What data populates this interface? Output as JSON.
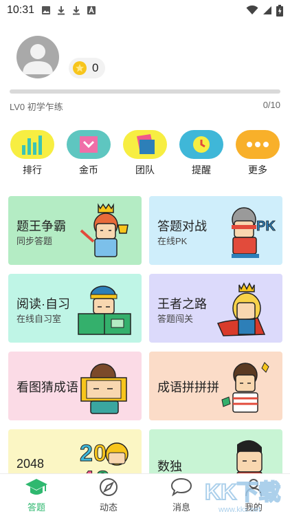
{
  "status_bar": {
    "time": "10:31",
    "left_icons": [
      "image-icon",
      "download-icon",
      "download-icon",
      "font-icon"
    ],
    "right_icons": [
      "wifi-icon",
      "signal-icon",
      "battery-icon"
    ]
  },
  "profile": {
    "avatar_icon": "user-avatar-icon",
    "coin_count": "0",
    "level_label": "LV0 初学乍练",
    "progress_text": "0/10",
    "progress_fraction": 0.0
  },
  "quick_actions": [
    {
      "label": "排行",
      "icon": "bar-chart-icon",
      "color": "#f7ee42"
    },
    {
      "label": "金币",
      "icon": "coin-box-icon",
      "color": "#5ec6c0"
    },
    {
      "label": "团队",
      "icon": "team-flag-icon",
      "color": "#f7ee42"
    },
    {
      "label": "提醒",
      "icon": "clock-icon",
      "color": "#3fb7d8"
    },
    {
      "label": "更多",
      "icon": "more-dots-icon",
      "color": "#f8b02a"
    }
  ],
  "cards": [
    {
      "title": "题王争霸",
      "subtitle": "同步答题",
      "bg": "#b4ecc4",
      "art": "crowned-boy-trophy-icon"
    },
    {
      "title": "答题对战",
      "subtitle": "在线PK",
      "bg": "#cfeefb",
      "art": "ninja-pk-icon"
    },
    {
      "title": "阅读·自习",
      "subtitle": "在线自习室",
      "bg": "#bff5e6",
      "art": "boy-reading-book-icon"
    },
    {
      "title": "王者之路",
      "subtitle": "答题闯关",
      "bg": "#dcdafb",
      "art": "caped-king-icon"
    },
    {
      "title": "看图猜成语",
      "subtitle": "",
      "bg": "#fbdbe6",
      "art": "boy-with-frame-icon"
    },
    {
      "title": "成语拼拼拼",
      "subtitle": "",
      "bg": "#fbdcc8",
      "art": "boy-puzzle-icon"
    },
    {
      "title": "2048",
      "subtitle": "",
      "bg": "#fbf6c4",
      "art": "2048-blocks-icon"
    },
    {
      "title": "数独",
      "subtitle": "",
      "bg": "#c8f4d4",
      "art": "sudoku-kid-icon"
    }
  ],
  "bottom_nav": [
    {
      "label": "答题",
      "icon": "graduation-cap-icon",
      "active": true
    },
    {
      "label": "动态",
      "icon": "compass-icon",
      "active": false
    },
    {
      "label": "消息",
      "icon": "chat-bubble-icon",
      "active": false
    },
    {
      "label": "我的",
      "icon": "user-icon",
      "active": false
    }
  ],
  "watermark": {
    "text": "KK下载",
    "url_text": "www.kkx.net"
  },
  "colors": {
    "accent": "#2fb86f",
    "progress_track": "#d9d9d9"
  }
}
